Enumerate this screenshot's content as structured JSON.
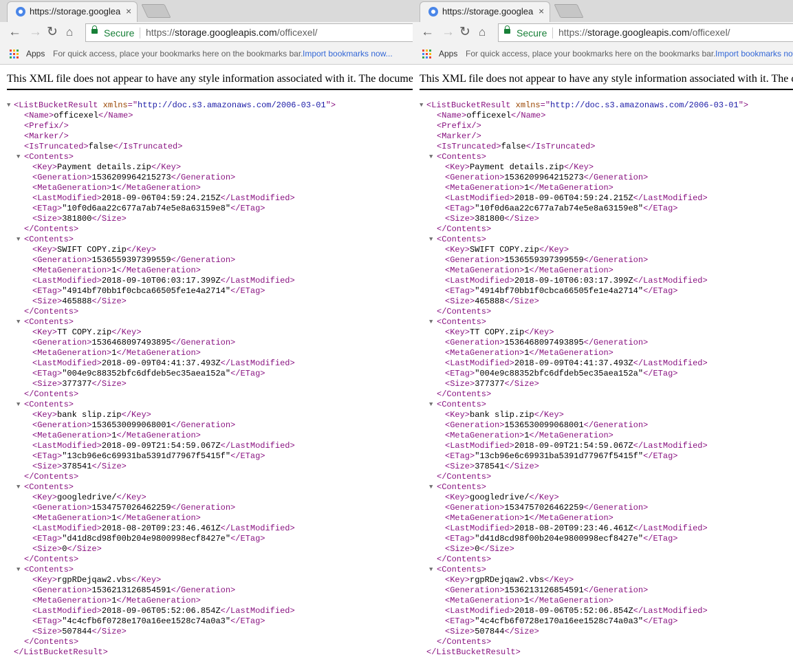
{
  "browser": {
    "tab_title": "https://storage.googleapis.com/officexel/",
    "tab_close": "×",
    "security_label": "Secure",
    "url_scheme": "https://",
    "url_host": "storage.googleapis.com",
    "url_path": "/officexel/",
    "nav_icons": {
      "back": "back-arrow-icon",
      "forward": "forward-arrow-icon",
      "reload": "reload-icon",
      "home": "home-icon"
    },
    "apps_label": "Apps",
    "bookmarks_hint": "For quick access, place your bookmarks here on the bookmarks bar.",
    "import_bookmarks": "Import bookmarks now..."
  },
  "xml_notice": "This XML file does not appear to have any style information associated with it. The document tree is shown below.",
  "xml": {
    "root_tag": "ListBucketResult",
    "xmlns_attr": "xmlns",
    "xmlns_value": "http://doc.s3.amazonaws.com/2006-03-01",
    "header": [
      {
        "tag": "Name",
        "value": "officexel"
      },
      {
        "tag": "Prefix",
        "value": ""
      },
      {
        "tag": "Marker",
        "value": ""
      },
      {
        "tag": "IsTruncated",
        "value": "false"
      }
    ],
    "contents": [
      {
        "Key": "Payment details.zip",
        "Generation": "1536209964215273",
        "MetaGeneration": "1",
        "LastModified": "2018-09-06T04:59:24.215Z",
        "ETag": "\"10f0d6aa22c677a7ab74e5e8a63159e8\"",
        "Size": "381800"
      },
      {
        "Key": "SWIFT COPY.zip",
        "Generation": "1536559397399559",
        "MetaGeneration": "1",
        "LastModified": "2018-09-10T06:03:17.399Z",
        "ETag": "\"4914bf70bb1f0cbca66505fe1e4a2714\"",
        "Size": "465888"
      },
      {
        "Key": "TT COPY.zip",
        "Generation": "1536468097493895",
        "MetaGeneration": "1",
        "LastModified": "2018-09-09T04:41:37.493Z",
        "ETag": "\"004e9c88352bfc6dfdeb5ec35aea152a\"",
        "Size": "377377"
      },
      {
        "Key": "bank slip.zip",
        "Generation": "1536530099068001",
        "MetaGeneration": "1",
        "LastModified": "2018-09-09T21:54:59.067Z",
        "ETag": "\"13cb96e6c69931ba5391d77967f5415f\"",
        "Size": "378541"
      },
      {
        "Key": "googledrive/",
        "Generation": "1534757026462259",
        "MetaGeneration": "1",
        "LastModified": "2018-08-20T09:23:46.461Z",
        "ETag": "\"d41d8cd98f00b204e9800998ecf8427e\"",
        "Size": "0"
      },
      {
        "Key": "rgpRDejqaw2.vbs",
        "Generation": "1536213126854591",
        "MetaGeneration": "1",
        "LastModified": "2018-09-06T05:52:06.854Z",
        "ETag": "\"4c4cfb6f0728e170a16ee1528c74a0a3\"",
        "Size": "507844"
      }
    ]
  }
}
